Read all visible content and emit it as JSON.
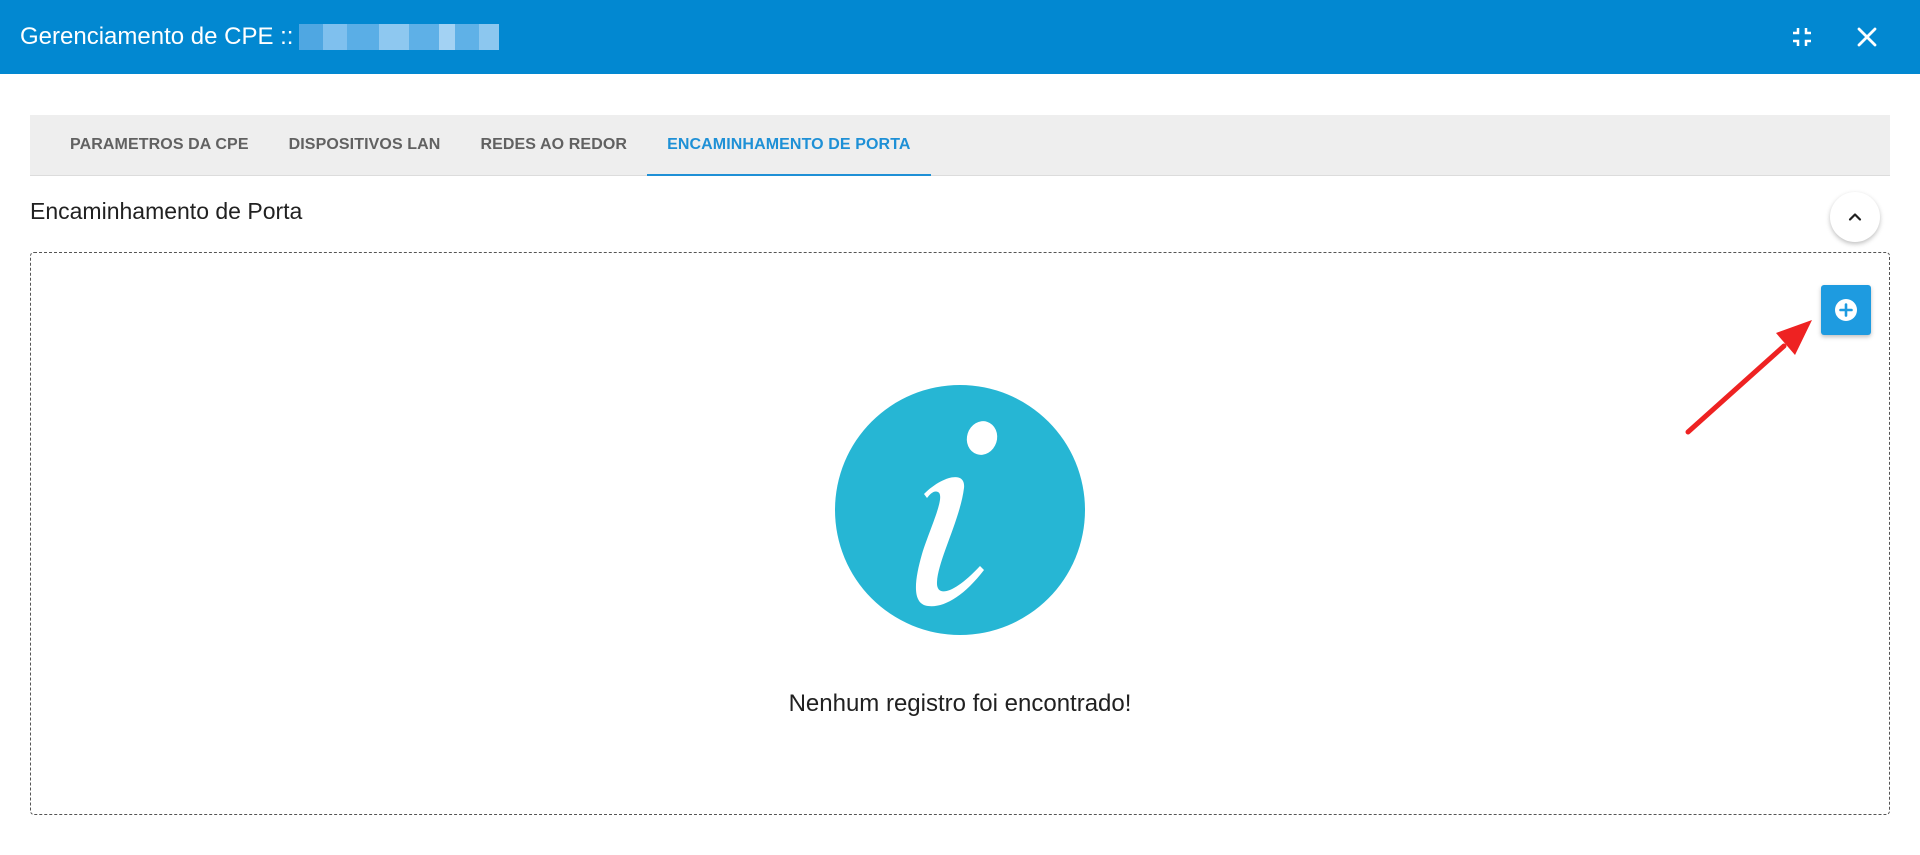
{
  "window": {
    "title": "Gerenciamento de CPE ::",
    "icons": {
      "minimize": "compress-icon",
      "close": "close-icon"
    }
  },
  "tabs": [
    {
      "label": "PARAMETROS DA CPE",
      "active": false
    },
    {
      "label": "DISPOSITIVOS LAN",
      "active": false
    },
    {
      "label": "REDES AO REDOR",
      "active": false
    },
    {
      "label": "ENCAMINHAMENTO DE PORTA",
      "active": true
    }
  ],
  "section": {
    "title": "Encaminhamento de Porta",
    "collapse_icon": "chevron-up-icon",
    "add_icon": "plus-circle-icon"
  },
  "empty_state": {
    "icon": "info-icon",
    "message": "Nenhum registro foi encontrado!"
  },
  "colors": {
    "header": "#0288d1",
    "accent": "#1e90d6",
    "info": "#26b6d4",
    "annotation_arrow": "#ee2222"
  }
}
